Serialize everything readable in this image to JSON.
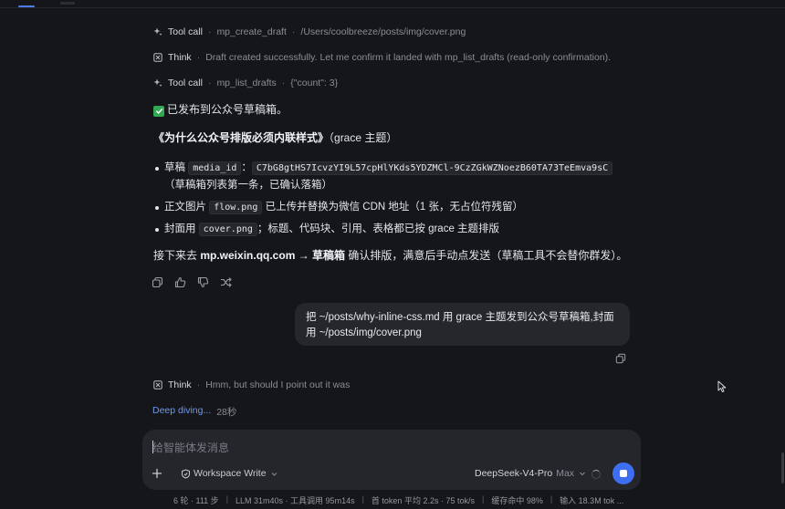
{
  "steps": [
    {
      "kind": "Tool call",
      "icon": "sparkle-icon",
      "name": "mp_create_draft",
      "detail": "/Users/coolbreeze/posts/img/cover.png"
    },
    {
      "kind": "Think",
      "icon": "think-icon",
      "name": "Draft created successfully. Let me confirm it landed with mp_list_drafts (read-only confirmation).",
      "detail": ""
    },
    {
      "kind": "Tool call",
      "icon": "sparkle-icon",
      "name": "mp_list_drafts",
      "detail": "{\"count\": 3}"
    }
  ],
  "assistant": {
    "published": "已发布到公众号草稿箱。",
    "article_title": "《为什么公众号排版必须内联样式》",
    "article_theme": "（grace 主题）",
    "bullets": [
      {
        "pre": "草稿 ",
        "code": "media_id",
        "mid": "：",
        "code2": "C7bG8gtHS7IcvzYI9L57cpHlYKds5YDZMCl-9CzZGkWZNoezB60TA73TeEmva9sC",
        "post": "（草稿箱列表第一条，已确认落箱）"
      },
      {
        "pre": "正文图片 ",
        "code": "flow.png",
        "post": " 已上传并替换为微信 CDN 地址（1 张，无占位符残留）"
      },
      {
        "pre": "封面用 ",
        "code": "cover.png",
        "post": "；标题、代码块、引用、表格都已按 grace 主题排版"
      }
    ],
    "next_pre": "接下来去 ",
    "next_bold": "mp.weixin.qq.com → 草稿箱",
    "next_post": " 确认排版，满意后手动点发送（草稿工具不会替你群发）。"
  },
  "user_message": "把 ~/posts/why-inline-css.md 用 grace 主题发到公众号草稿箱,封面用 ~/posts/img/cover.png",
  "current_think": {
    "kind": "Think",
    "text": "Hmm, but should I point out it was"
  },
  "deep_diving": {
    "label": "Deep diving...",
    "time": "28秒"
  },
  "composer": {
    "placeholder": "给智能体发消息",
    "mode": "Workspace Write",
    "model": "DeepSeek-V4-Pro",
    "model_tier": "Max"
  },
  "status_bar": [
    "6 轮 · 111 步",
    "LLM 31m40s · 工具调用 95m14s",
    "首 token 平均 2.2s · 75 tok/s",
    "缓存命中 98%",
    "输入 18.3M tok ..."
  ],
  "colors": {
    "accent": "#3e6ff0",
    "link": "#6a98f6",
    "check": "#34a853",
    "background": "#15161a"
  }
}
